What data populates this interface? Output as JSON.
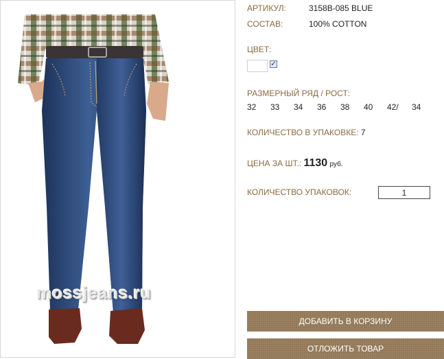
{
  "product": {
    "article_label": "АРТИКУЛ:",
    "article_value": "3158B-085 BLUE",
    "composition_label": "СОСТАВ:",
    "composition_value": "100% COTTON",
    "color_label": "ЦВЕТ:",
    "color_checked": true,
    "sizes_label": "РАЗМЕРНЫЙ РЯД / РОСТ:",
    "sizes": [
      "32",
      "33",
      "34",
      "36",
      "38",
      "40",
      "42/",
      "34"
    ],
    "pack_qty_label": "КОЛИЧЕСТВО В УПАКОВКЕ:",
    "pack_qty_value": "7",
    "price_label": "ЦЕНА ЗА ШТ.:",
    "price_value": "1130",
    "price_unit": "руб.",
    "packs_label": "КОЛИЧЕСТВО УПАКОВОК:",
    "packs_value": "1"
  },
  "image": {
    "watermark": "mossjeans.ru"
  },
  "buttons": {
    "add_to_cart": "ДОБАВИТЬ В КОРЗИНУ",
    "postpone": "ОТЛОЖИТЬ ТОВАР"
  },
  "colors": {
    "label": "#8b6a3f",
    "button": "#8f7452",
    "denim": "#2c4a7a"
  }
}
